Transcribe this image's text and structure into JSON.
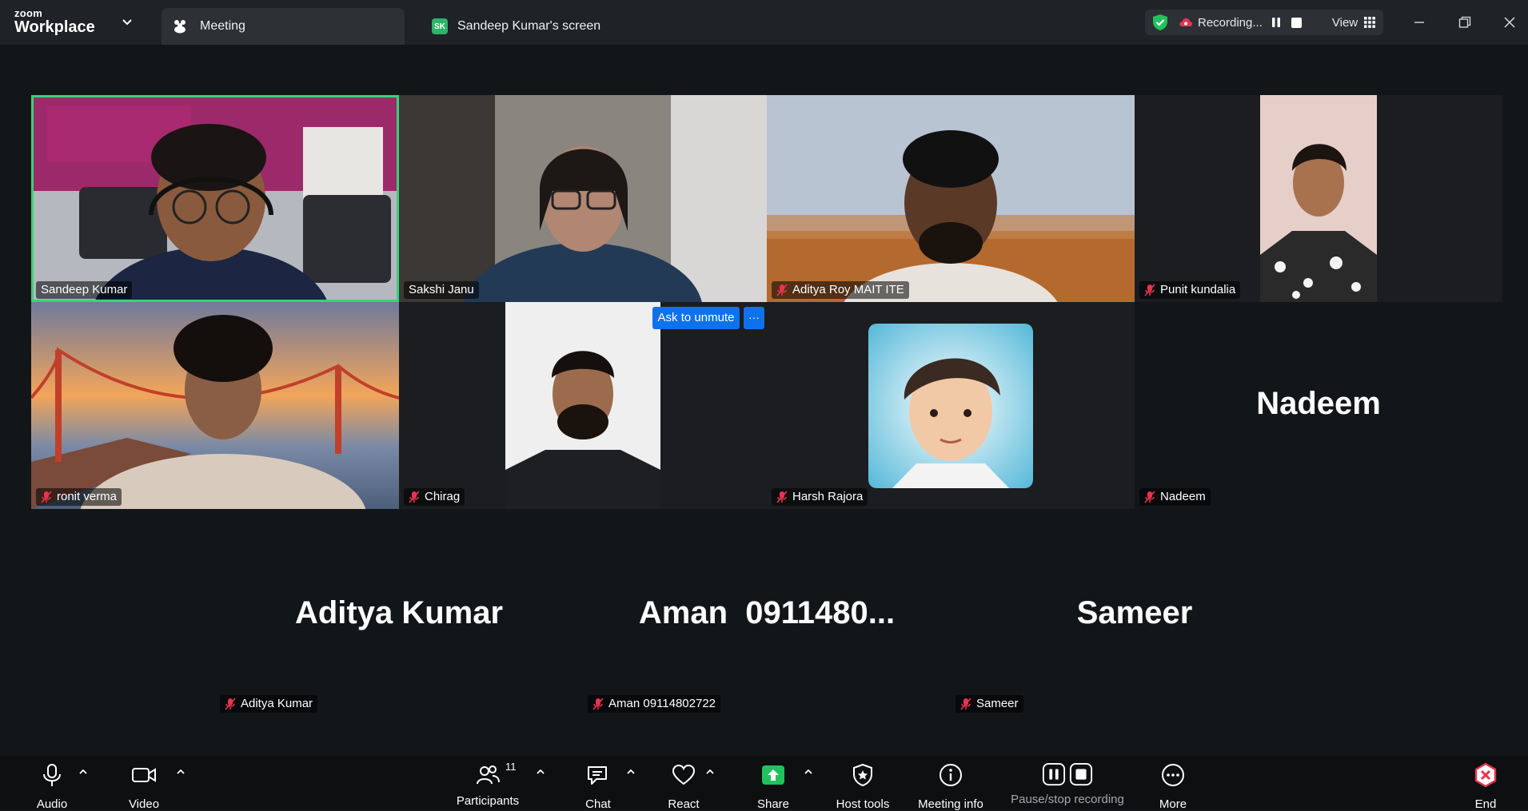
{
  "app": {
    "logo_line1": "zoom",
    "logo_line2": "Workplace"
  },
  "tabs": [
    {
      "label": "Meeting"
    },
    {
      "label": "Sandeep Kumar's screen",
      "badge": "SK"
    }
  ],
  "recording": {
    "label": "Recording...",
    "view_label": "View"
  },
  "tile_actions": {
    "ask_to_unmute": "Ask to unmute",
    "more": "···"
  },
  "participants_tiles": [
    {
      "name": "Sandeep Kumar",
      "muted": false,
      "active_speaker": true
    },
    {
      "name": "Sakshi Janu",
      "muted": false
    },
    {
      "name": "Aditya Roy MAIT ITE",
      "muted": true
    },
    {
      "name": "Punit kundalia",
      "muted": true
    },
    {
      "name": "ronit verma",
      "muted": true
    },
    {
      "name": "Chirag",
      "muted": true
    },
    {
      "name": "Harsh Rajora",
      "muted": true
    },
    {
      "name": "Nadeem",
      "muted": true,
      "big_label": "Nadeem"
    },
    {
      "name": "Aditya Kumar",
      "muted": true,
      "big_label": "Aditya Kumar"
    },
    {
      "name": "Aman 09114802722",
      "muted": true,
      "big_label": "Aman  0911480..."
    },
    {
      "name": "Sameer",
      "muted": true,
      "big_label": "Sameer"
    }
  ],
  "toolbar": {
    "audio": "Audio",
    "video": "Video",
    "participants": "Participants",
    "participants_count": "11",
    "chat": "Chat",
    "react": "React",
    "share": "Share",
    "host_tools": "Host tools",
    "meeting_info": "Meeting info",
    "pause_stop_recording": "Pause/stop recording",
    "more": "More",
    "end": "End"
  },
  "colors": {
    "active_speaker_border": "#3ad17a",
    "share_green": "#23c15d",
    "end_red": "#e8344e",
    "unmute_blue": "#0e72ed"
  },
  "icons": [
    "shield-check-icon",
    "cloud-record-icon",
    "pause-icon",
    "stop-icon",
    "grid-icon",
    "mic-muted-icon",
    "mic-icon",
    "video-icon",
    "participants-icon",
    "chat-icon",
    "heart-icon",
    "share-arrow-icon",
    "host-shield-icon",
    "info-icon",
    "more-dots-icon",
    "close-x-icon"
  ]
}
